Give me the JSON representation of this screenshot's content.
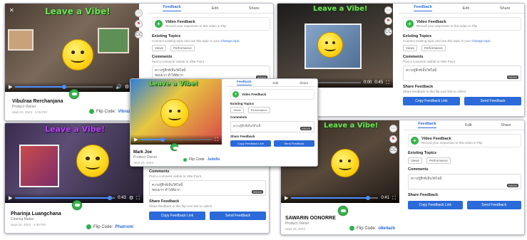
{
  "panel_top_left": {
    "title": "Leave a Vibe!",
    "name": "Vibulraa Rerchanjana",
    "role": "Product Owner",
    "meta": "Sept 20, 2023 · 4:45 PM",
    "flip_label": "Flip Code:",
    "flip_code": "Vibra2c"
  },
  "panel_top_right": {
    "title": "Leave a Vibe!",
    "time": "0:00",
    "duration": "0:45"
  },
  "panel_center": {
    "title": "Leave a Vibe!",
    "name": "Mark Joe",
    "role": "Product Owner",
    "meta": "Sept 20, 2023",
    "flip_label": "Flip Code:",
    "flip_code": "Jedo5o"
  },
  "panel_bottom_left": {
    "title": "Leave a Vibe!",
    "name": "Pharinja Luangchana",
    "role": "Cinema Maker",
    "meta": "Sept 20, 2023 · 4:45 PM",
    "flip_label": "Flip Code:",
    "flip_code": "Phatrxmi",
    "time": "0:43"
  },
  "panel_bottom_right": {
    "title": "Leave a Vibe!",
    "name": "SAWARIN OONORRE",
    "role": "Product Owner",
    "meta": "Sept 20, 2023",
    "flip_label": "Flip Code:",
    "flip_code": "o8e4azb",
    "time": "0:41"
  },
  "sidebar": {
    "tabs": [
      "Feedback",
      "Edit",
      "Share"
    ],
    "video_feedback_title": "Video Feedback",
    "video_feedback_desc": "Record your responses to this video in Flip",
    "existing_topics": "Existing Topics",
    "existing_topics_desc": "Connect existing topic and use this topic in your",
    "change_topic": "Change topic",
    "rating_left": "Views",
    "rating_right": "Performance",
    "comments": "Comments",
    "comments_desc": "Post a comment visible to Vibe Point",
    "comment_line1": "ความรู้สึกที่เห็นวิดีโอนี้",
    "comment_line2": "ชอบมาก ทำได้ดีมาก",
    "comment_count": "0/5000",
    "share_feedback": "Share Feedback",
    "share_feedback_desc": "Share feedback in this flip.com link to collect",
    "copy_link": "Copy Feedback Link",
    "send_feedback": "Send Feedback"
  },
  "colors": {
    "title_green": "#7ad85c",
    "title_purple": "#b14ae8",
    "brand_blue": "#2b6ad8",
    "flip_green": "#35b54a",
    "smiley_yellow": "#ffd81e"
  }
}
